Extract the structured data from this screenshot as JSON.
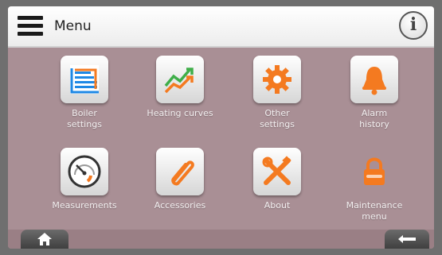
{
  "header": {
    "title": "Menu",
    "info_label": "i"
  },
  "tiles": [
    {
      "label_line1": "Boiler",
      "label_line2": "settings",
      "icon": "boiler-settings-icon"
    },
    {
      "label_line1": "Heating curves",
      "label_line2": "",
      "icon": "heating-curves-icon"
    },
    {
      "label_line1": "Other",
      "label_line2": "settings",
      "icon": "gear-icon"
    },
    {
      "label_line1": "Alarm",
      "label_line2": "history",
      "icon": "bell-icon"
    },
    {
      "label_line1": "Measurements",
      "label_line2": "",
      "icon": "gauge-icon"
    },
    {
      "label_line1": "Accessories",
      "label_line2": "",
      "icon": "paperclip-icon"
    },
    {
      "label_line1": "About",
      "label_line2": "",
      "icon": "tools-icon"
    },
    {
      "label_line1": "Maintenance",
      "label_line2": "menu",
      "icon": "lock-icon"
    }
  ],
  "footer": {
    "home_icon": "home-icon",
    "back_icon": "back-arrow-icon"
  },
  "colors": {
    "background": "#a98f95",
    "accent": "#f47a20",
    "header": "#ffffff"
  }
}
